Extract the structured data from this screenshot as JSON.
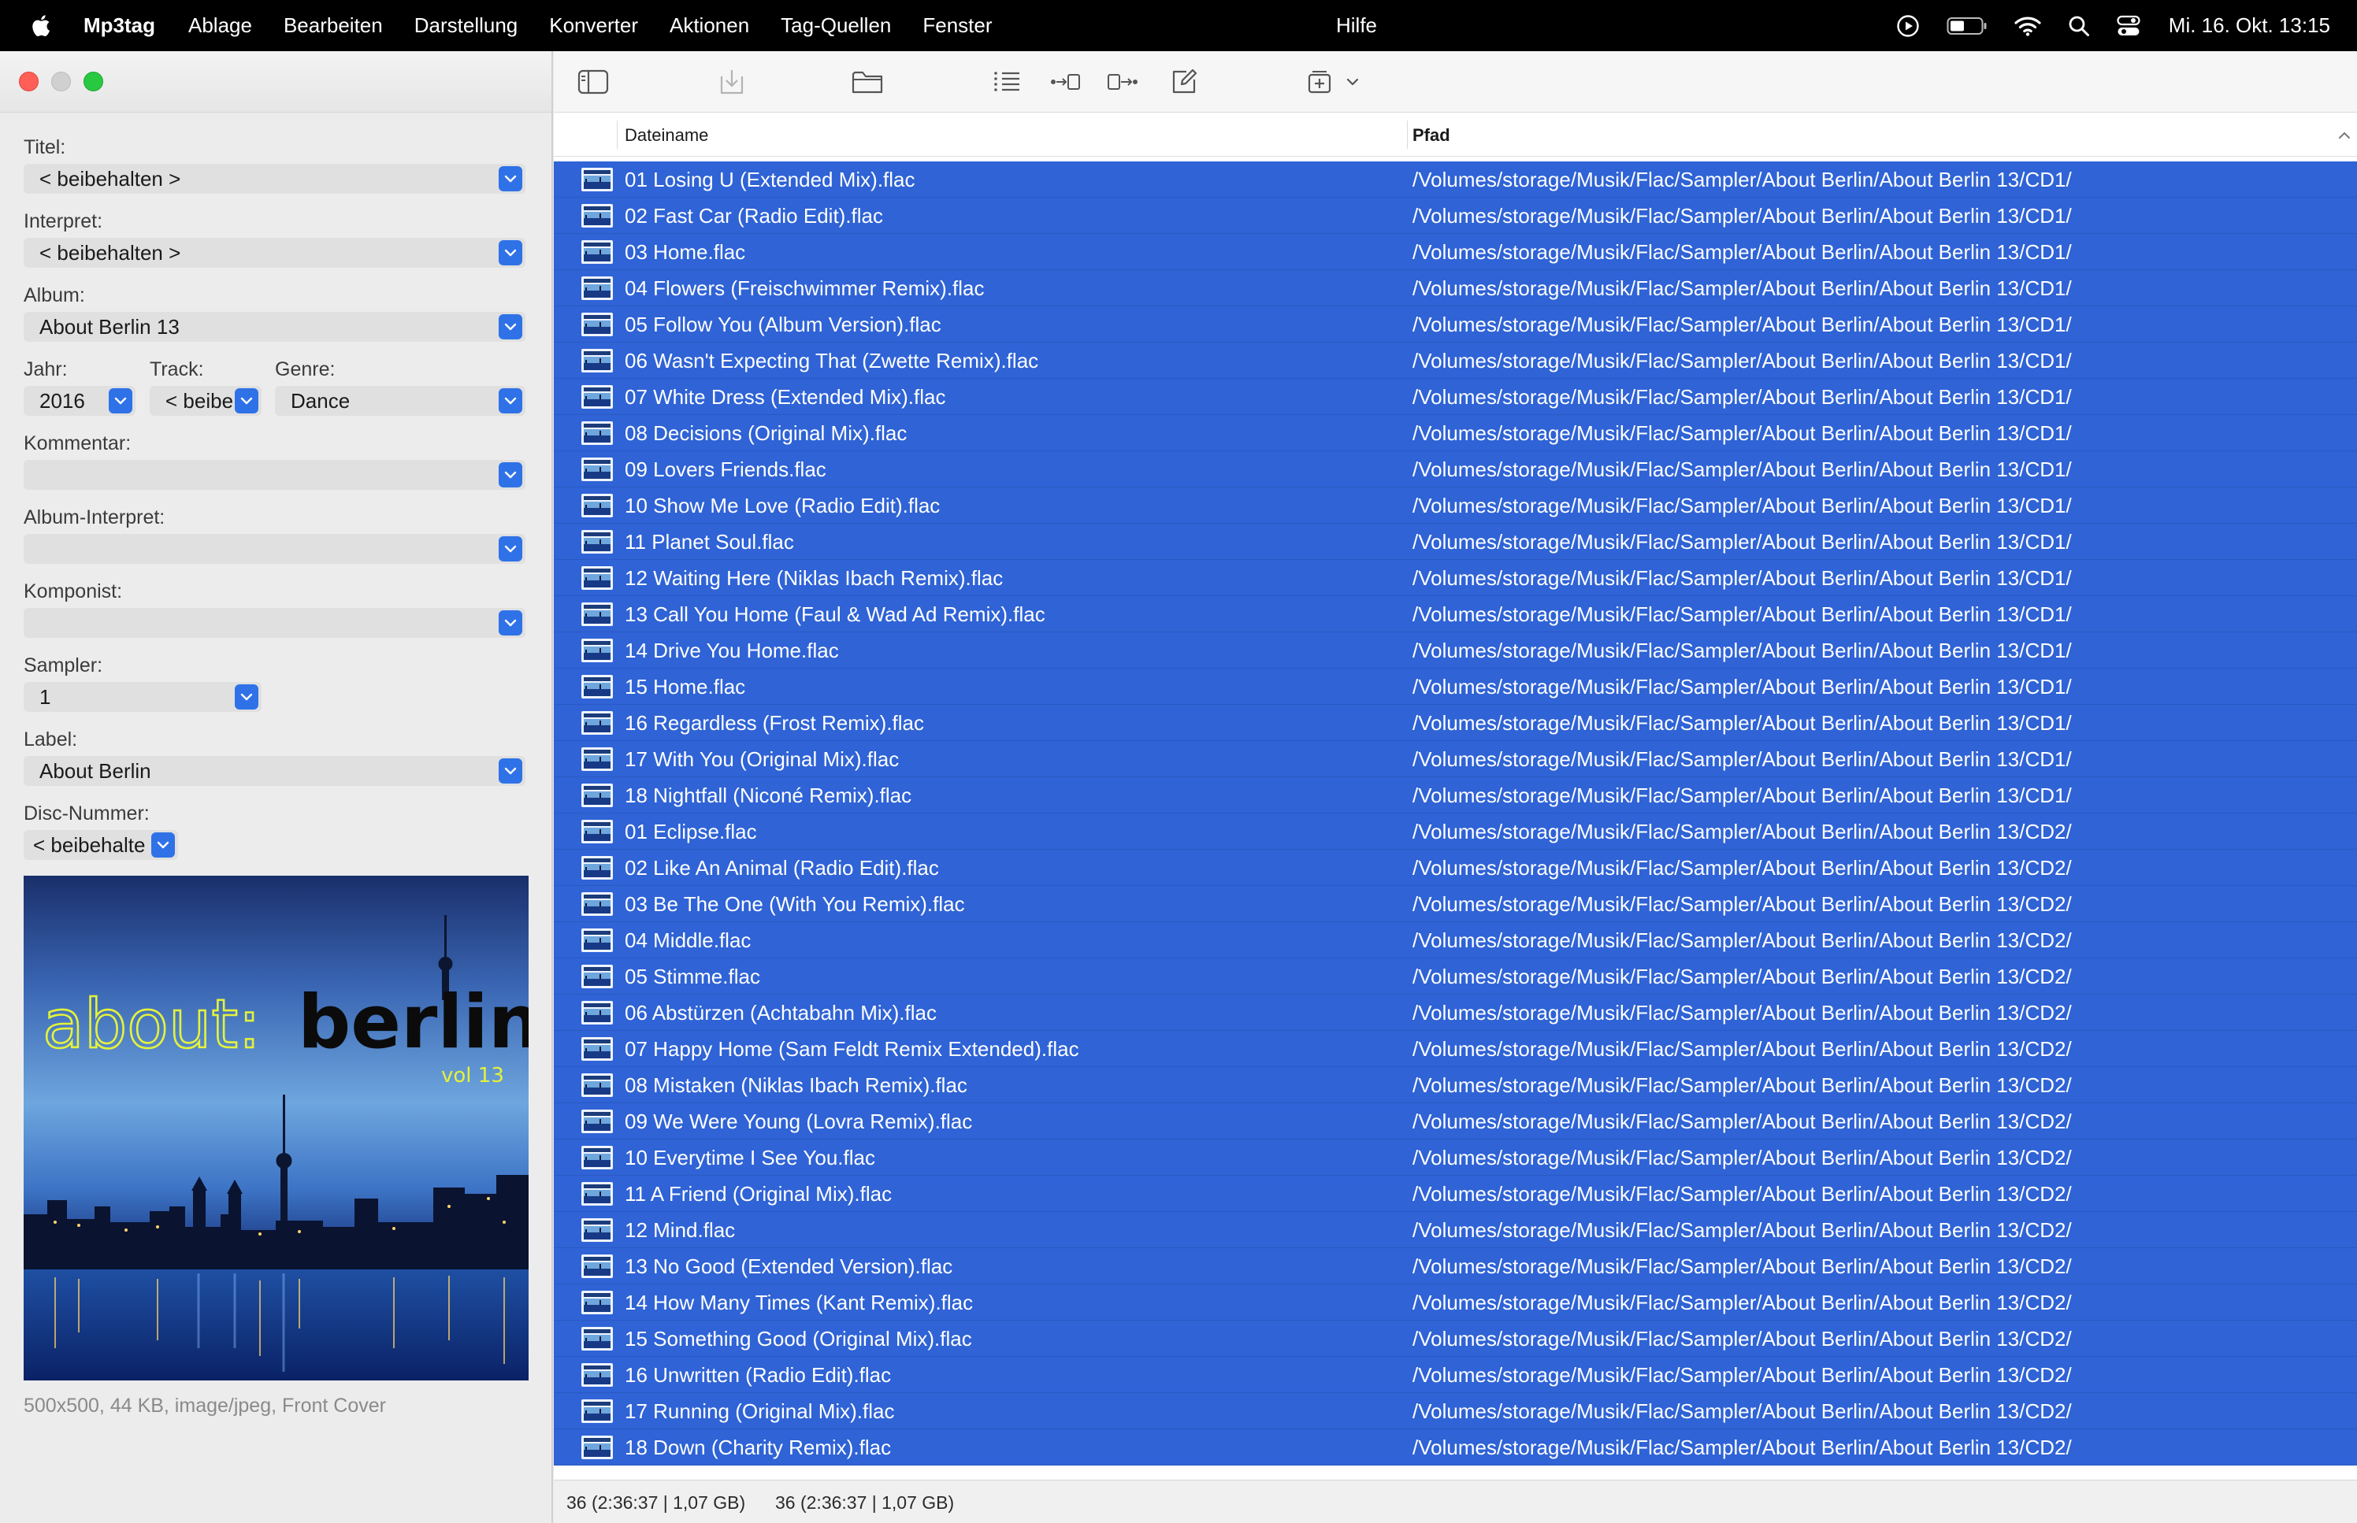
{
  "menubar": {
    "app_name": "Mp3tag",
    "items": [
      "Ablage",
      "Bearbeiten",
      "Darstellung",
      "Konverter",
      "Aktionen",
      "Tag-Quellen",
      "Fenster"
    ],
    "help": "Hilfe",
    "clock": "Mi. 16. Okt. 13:15"
  },
  "tag_panel": {
    "title": {
      "label": "Titel:",
      "value": "< beibehalten >"
    },
    "artist": {
      "label": "Interpret:",
      "value": "< beibehalten >"
    },
    "album": {
      "label": "Album:",
      "value": "About Berlin 13"
    },
    "year": {
      "label": "Jahr:",
      "value": "2016"
    },
    "track": {
      "label": "Track:",
      "value": "< beibe"
    },
    "genre": {
      "label": "Genre:",
      "value": "Dance"
    },
    "comment": {
      "label": "Kommentar:",
      "value": ""
    },
    "album_artist": {
      "label": "Album-Interpret:",
      "value": ""
    },
    "composer": {
      "label": "Komponist:",
      "value": ""
    },
    "sampler": {
      "label": "Sampler:",
      "value": "1"
    },
    "label": {
      "label": "Label:",
      "value": "About Berlin"
    },
    "disc": {
      "label": "Disc-Nummer:",
      "value": "< beibehalte"
    },
    "cover": {
      "logo_text_1": "about:",
      "logo_text_2": "berlin",
      "logo_vol": "vol 13",
      "caption": "500x500, 44 KB, image/jpeg, Front Cover"
    }
  },
  "file_list": {
    "columns": {
      "filename": "Dateiname",
      "path": "Pfad"
    },
    "rows": [
      {
        "filename": "01 Losing U (Extended Mix).flac",
        "path": "/Volumes/storage/Musik/Flac/Sampler/About Berlin/About Berlin 13/CD1/"
      },
      {
        "filename": "02 Fast Car (Radio Edit).flac",
        "path": "/Volumes/storage/Musik/Flac/Sampler/About Berlin/About Berlin 13/CD1/"
      },
      {
        "filename": "03 Home.flac",
        "path": "/Volumes/storage/Musik/Flac/Sampler/About Berlin/About Berlin 13/CD1/"
      },
      {
        "filename": "04 Flowers (Freischwimmer Remix).flac",
        "path": "/Volumes/storage/Musik/Flac/Sampler/About Berlin/About Berlin 13/CD1/"
      },
      {
        "filename": "05 Follow You (Album Version).flac",
        "path": "/Volumes/storage/Musik/Flac/Sampler/About Berlin/About Berlin 13/CD1/"
      },
      {
        "filename": "06 Wasn't Expecting That (Zwette Remix).flac",
        "path": "/Volumes/storage/Musik/Flac/Sampler/About Berlin/About Berlin 13/CD1/"
      },
      {
        "filename": "07 White Dress (Extended Mix).flac",
        "path": "/Volumes/storage/Musik/Flac/Sampler/About Berlin/About Berlin 13/CD1/"
      },
      {
        "filename": "08 Decisions (Original Mix).flac",
        "path": "/Volumes/storage/Musik/Flac/Sampler/About Berlin/About Berlin 13/CD1/"
      },
      {
        "filename": "09 Lovers Friends.flac",
        "path": "/Volumes/storage/Musik/Flac/Sampler/About Berlin/About Berlin 13/CD1/"
      },
      {
        "filename": "10 Show Me Love (Radio Edit).flac",
        "path": "/Volumes/storage/Musik/Flac/Sampler/About Berlin/About Berlin 13/CD1/"
      },
      {
        "filename": "11 Planet Soul.flac",
        "path": "/Volumes/storage/Musik/Flac/Sampler/About Berlin/About Berlin 13/CD1/"
      },
      {
        "filename": "12 Waiting Here (Niklas Ibach Remix).flac",
        "path": "/Volumes/storage/Musik/Flac/Sampler/About Berlin/About Berlin 13/CD1/"
      },
      {
        "filename": "13 Call You Home (Faul & Wad Ad Remix).flac",
        "path": "/Volumes/storage/Musik/Flac/Sampler/About Berlin/About Berlin 13/CD1/"
      },
      {
        "filename": "14 Drive You Home.flac",
        "path": "/Volumes/storage/Musik/Flac/Sampler/About Berlin/About Berlin 13/CD1/"
      },
      {
        "filename": "15 Home.flac",
        "path": "/Volumes/storage/Musik/Flac/Sampler/About Berlin/About Berlin 13/CD1/"
      },
      {
        "filename": "16 Regardless (Frost Remix).flac",
        "path": "/Volumes/storage/Musik/Flac/Sampler/About Berlin/About Berlin 13/CD1/"
      },
      {
        "filename": "17 With You (Original Mix).flac",
        "path": "/Volumes/storage/Musik/Flac/Sampler/About Berlin/About Berlin 13/CD1/"
      },
      {
        "filename": "18 Nightfall (Niconé Remix).flac",
        "path": "/Volumes/storage/Musik/Flac/Sampler/About Berlin/About Berlin 13/CD1/"
      },
      {
        "filename": "01 Eclipse.flac",
        "path": "/Volumes/storage/Musik/Flac/Sampler/About Berlin/About Berlin 13/CD2/"
      },
      {
        "filename": "02 Like An Animal (Radio Edit).flac",
        "path": "/Volumes/storage/Musik/Flac/Sampler/About Berlin/About Berlin 13/CD2/"
      },
      {
        "filename": "03 Be The One (With You Remix).flac",
        "path": "/Volumes/storage/Musik/Flac/Sampler/About Berlin/About Berlin 13/CD2/"
      },
      {
        "filename": "04 Middle.flac",
        "path": "/Volumes/storage/Musik/Flac/Sampler/About Berlin/About Berlin 13/CD2/"
      },
      {
        "filename": "05 Stimme.flac",
        "path": "/Volumes/storage/Musik/Flac/Sampler/About Berlin/About Berlin 13/CD2/"
      },
      {
        "filename": "06 Abstürzen (Achtabahn Mix).flac",
        "path": "/Volumes/storage/Musik/Flac/Sampler/About Berlin/About Berlin 13/CD2/"
      },
      {
        "filename": "07 Happy Home (Sam Feldt Remix Extended).flac",
        "path": "/Volumes/storage/Musik/Flac/Sampler/About Berlin/About Berlin 13/CD2/"
      },
      {
        "filename": "08 Mistaken (Niklas Ibach Remix).flac",
        "path": "/Volumes/storage/Musik/Flac/Sampler/About Berlin/About Berlin 13/CD2/"
      },
      {
        "filename": "09 We Were Young (Lovra Remix).flac",
        "path": "/Volumes/storage/Musik/Flac/Sampler/About Berlin/About Berlin 13/CD2/"
      },
      {
        "filename": "10 Everytime I See You.flac",
        "path": "/Volumes/storage/Musik/Flac/Sampler/About Berlin/About Berlin 13/CD2/"
      },
      {
        "filename": "11 A Friend (Original Mix).flac",
        "path": "/Volumes/storage/Musik/Flac/Sampler/About Berlin/About Berlin 13/CD2/"
      },
      {
        "filename": "12 Mind.flac",
        "path": "/Volumes/storage/Musik/Flac/Sampler/About Berlin/About Berlin 13/CD2/"
      },
      {
        "filename": "13 No Good (Extended Version).flac",
        "path": "/Volumes/storage/Musik/Flac/Sampler/About Berlin/About Berlin 13/CD2/"
      },
      {
        "filename": "14 How Many Times (Kant Remix).flac",
        "path": "/Volumes/storage/Musik/Flac/Sampler/About Berlin/About Berlin 13/CD2/"
      },
      {
        "filename": "15 Something Good (Original Mix).flac",
        "path": "/Volumes/storage/Musik/Flac/Sampler/About Berlin/About Berlin 13/CD2/"
      },
      {
        "filename": "16 Unwritten (Radio Edit).flac",
        "path": "/Volumes/storage/Musik/Flac/Sampler/About Berlin/About Berlin 13/CD2/"
      },
      {
        "filename": "17 Running (Original Mix).flac",
        "path": "/Volumes/storage/Musik/Flac/Sampler/About Berlin/About Berlin 13/CD2/"
      },
      {
        "filename": "18 Down (Charity Remix).flac",
        "path": "/Volumes/storage/Musik/Flac/Sampler/About Berlin/About Berlin 13/CD2/"
      }
    ]
  },
  "statusbar": {
    "selected": "36 (2:36:37 | 1,07 GB)",
    "total": "36 (2:36:37 | 1,07 GB)"
  },
  "colors": {
    "selection": "#2f63d6",
    "accent_button": "#2f72e8",
    "logo_yellow": "#e4f23a"
  }
}
